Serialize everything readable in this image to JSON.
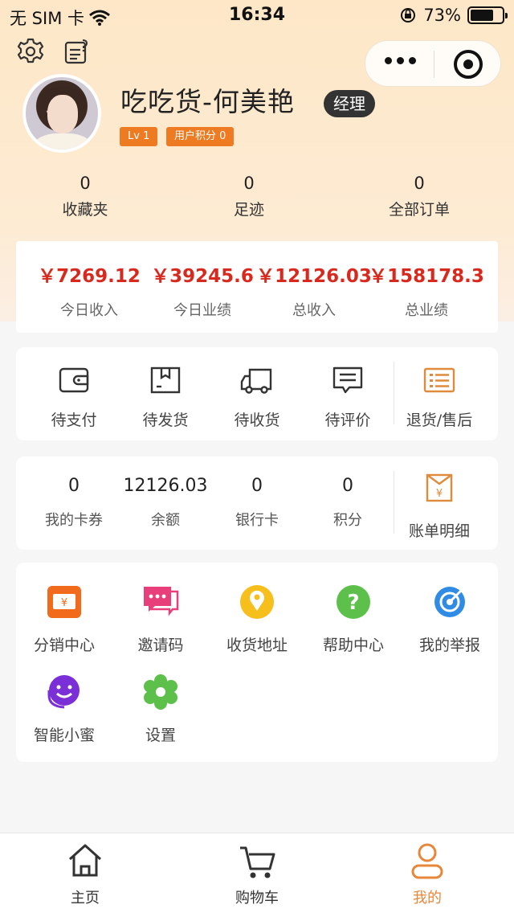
{
  "status_bar": {
    "carrier": "无 SIM 卡",
    "time": "16:34",
    "battery": "73%",
    "battery_level": 0.73
  },
  "profile": {
    "name": "吃吃货-何美艳",
    "role": "经理",
    "level": "Lv 1",
    "points": "用户积分 0"
  },
  "stats": [
    {
      "value": "0",
      "label": "收藏夹"
    },
    {
      "value": "0",
      "label": "足迹"
    },
    {
      "value": "0",
      "label": "全部订单"
    }
  ],
  "earnings": [
    {
      "value": "￥7269.12",
      "label": "今日收入"
    },
    {
      "value": "￥39245.6",
      "label": "今日业绩"
    },
    {
      "value": "￥12126.03",
      "label": "总收入"
    },
    {
      "value": "￥158178.3",
      "label": "总业绩"
    }
  ],
  "orders": [
    {
      "label": "待支付",
      "icon": "wallet-icon"
    },
    {
      "label": "待发货",
      "icon": "package-icon"
    },
    {
      "label": "待收货",
      "icon": "truck-icon"
    },
    {
      "label": "待评价",
      "icon": "comment-icon"
    },
    {
      "label": "退货/售后",
      "icon": "return-list-icon"
    }
  ],
  "wallet": [
    {
      "value": "0",
      "label": "我的卡券"
    },
    {
      "value": "12126.03",
      "label": "余额"
    },
    {
      "value": "0",
      "label": "银行卡"
    },
    {
      "value": "0",
      "label": "积分"
    }
  ],
  "bill": {
    "label": "账单明细",
    "icon": "bill-icon"
  },
  "services": [
    {
      "label": "分销中心",
      "icon": "distribution-icon",
      "color": "#f26b1d"
    },
    {
      "label": "邀请码",
      "icon": "invite-message-icon",
      "color": "#e83e7a"
    },
    {
      "label": "收货地址",
      "icon": "location-pin-icon",
      "color": "#f6bf1c"
    },
    {
      "label": "帮助中心",
      "icon": "help-icon",
      "color": "#5cc04a"
    },
    {
      "label": "我的举报",
      "icon": "report-target-icon",
      "color": "#2f8be6"
    },
    {
      "label": "智能小蜜",
      "icon": "smart-assistant-icon",
      "color": "#7b2fd6"
    },
    {
      "label": "设置",
      "icon": "settings-flower-icon",
      "color": "#5cc04a"
    }
  ],
  "tabbar": [
    {
      "label": "主页",
      "icon": "home-icon"
    },
    {
      "label": "购物车",
      "icon": "cart-icon"
    },
    {
      "label": "我的",
      "icon": "profile-icon",
      "active": true
    }
  ],
  "colors": {
    "accent": "#ee7b22",
    "price": "#d8291e",
    "active_tab": "#e8873a"
  }
}
